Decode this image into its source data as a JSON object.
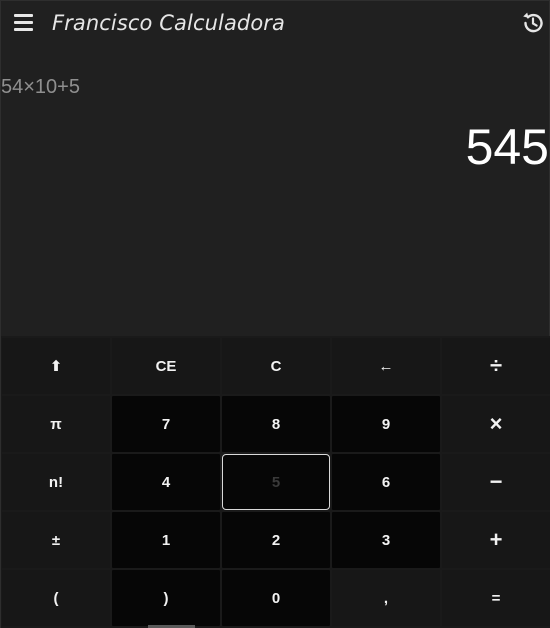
{
  "header": {
    "title": "Francisco Calculadora",
    "menu_icon": "hamburger-menu-icon",
    "history_icon": "history-icon"
  },
  "display": {
    "expression": "54×10+5",
    "result": "545"
  },
  "keypad": {
    "rows": [
      [
        {
          "label": "⬆",
          "name": "shift-button",
          "kind": "fn"
        },
        {
          "label": "CE",
          "name": "clear-entry-button",
          "kind": "fn"
        },
        {
          "label": "C",
          "name": "clear-button",
          "kind": "fn"
        },
        {
          "label": "←",
          "name": "backspace-button",
          "kind": "fn"
        },
        {
          "label": "÷",
          "name": "divide-button",
          "kind": "fn op"
        }
      ],
      [
        {
          "label": "π",
          "name": "pi-button",
          "kind": "fn"
        },
        {
          "label": "7",
          "name": "digit-7-button",
          "kind": "num"
        },
        {
          "label": "8",
          "name": "digit-8-button",
          "kind": "num"
        },
        {
          "label": "9",
          "name": "digit-9-button",
          "kind": "num"
        },
        {
          "label": "×",
          "name": "multiply-button",
          "kind": "fn op"
        }
      ],
      [
        {
          "label": "n!",
          "name": "factorial-button",
          "kind": "fn"
        },
        {
          "label": "4",
          "name": "digit-4-button",
          "kind": "num"
        },
        {
          "label": "5",
          "name": "digit-5-button",
          "kind": "num focused"
        },
        {
          "label": "6",
          "name": "digit-6-button",
          "kind": "num"
        },
        {
          "label": "−",
          "name": "minus-button",
          "kind": "fn op"
        }
      ],
      [
        {
          "label": "±",
          "name": "negate-button",
          "kind": "fn"
        },
        {
          "label": "1",
          "name": "digit-1-button",
          "kind": "num"
        },
        {
          "label": "2",
          "name": "digit-2-button",
          "kind": "num"
        },
        {
          "label": "3",
          "name": "digit-3-button",
          "kind": "num"
        },
        {
          "label": "+",
          "name": "plus-button",
          "kind": "fn op"
        }
      ],
      [
        {
          "label": "(",
          "name": "open-paren-button",
          "kind": "fn"
        },
        {
          "label": ")",
          "name": "close-paren-button",
          "kind": "num"
        },
        {
          "label": "0",
          "name": "digit-0-button",
          "kind": "num"
        },
        {
          "label": ",",
          "name": "decimal-button",
          "kind": "fn"
        },
        {
          "label": "=",
          "name": "equals-button",
          "kind": "fn"
        }
      ]
    ]
  },
  "colors": {
    "background": "#202020",
    "number_key": "#060606",
    "function_key": "#171717",
    "text": "#f2f2f2",
    "expression_text": "#8f8f8f"
  }
}
